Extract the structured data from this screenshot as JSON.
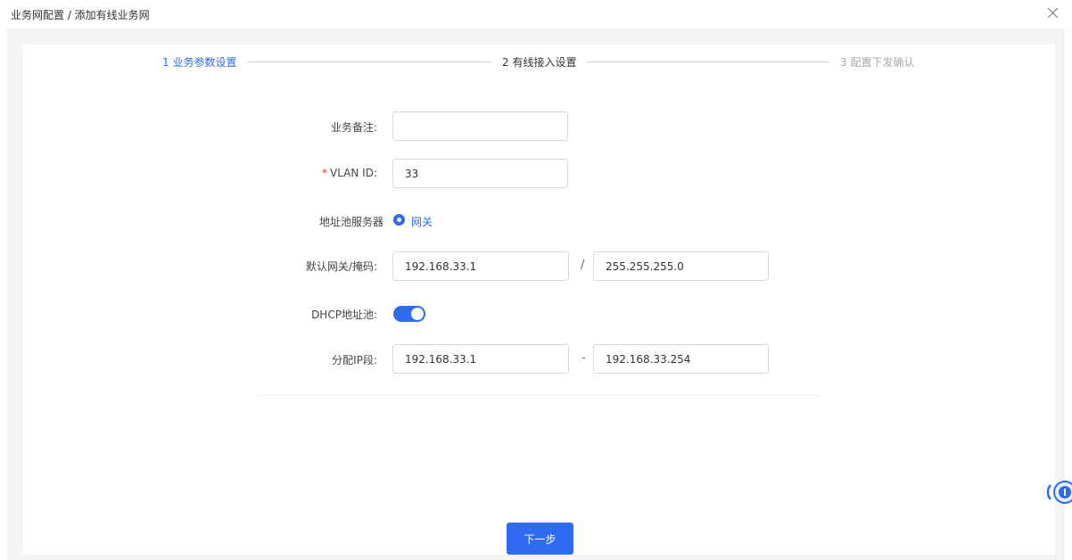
{
  "header": {
    "breadcrumb": "业务网配置 / 添加有线业务网"
  },
  "steps": [
    {
      "label": "1 业务参数设置",
      "state": "done"
    },
    {
      "label": "2 有线接入设置",
      "state": "active"
    },
    {
      "label": "3 配置下发确认",
      "state": "pending"
    }
  ],
  "form": {
    "remark_label": "业务备注:",
    "remark_value": "",
    "vlan_required": "*",
    "vlan_label": "VLAN ID:",
    "vlan_value": "33",
    "pool_server_label": "地址池服务器",
    "pool_server_option": "网关",
    "gateway_label": "默认网关/掩码:",
    "gateway_value": "192.168.33.1",
    "gateway_sep": "/",
    "mask_value": "255.255.255.0",
    "dhcp_label": "DHCP地址池:",
    "dhcp_enabled": true,
    "ip_range_label": "分配IP段:",
    "ip_start": "192.168.33.1",
    "ip_range_sep": "-",
    "ip_end": "192.168.33.254"
  },
  "footer": {
    "next_label": "下一步"
  },
  "colors": {
    "accent": "#2f6bf2",
    "required": "#f5222d"
  }
}
